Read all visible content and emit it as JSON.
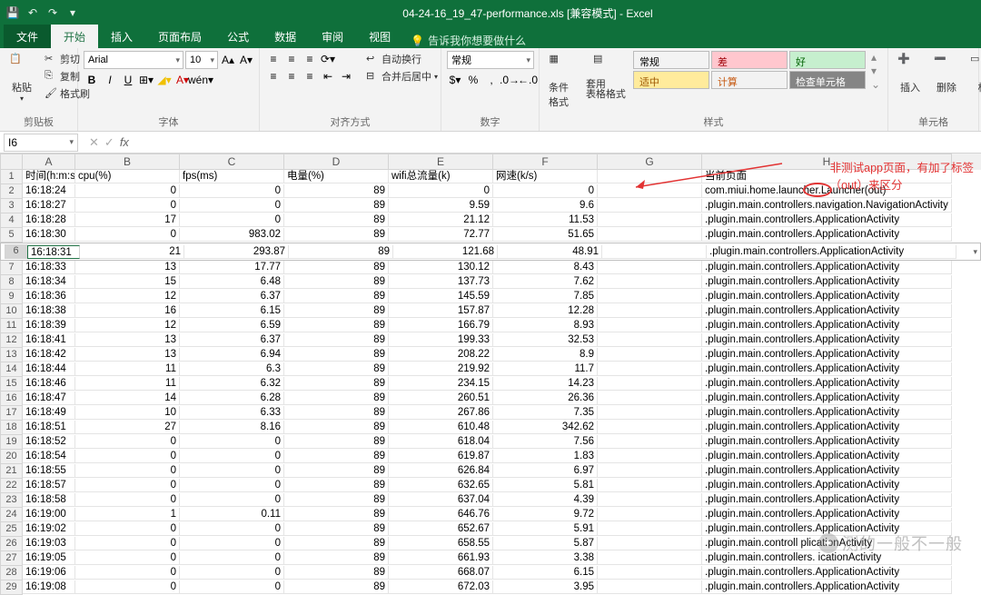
{
  "title": "04-24-16_19_47-performance.xls  [兼容模式]  -  Excel",
  "qat": {
    "save": "💾",
    "undo": "↶",
    "redo": "↷",
    "custom": "▾"
  },
  "tabs": {
    "file": "文件",
    "home": "开始",
    "insert": "插入",
    "layout": "页面布局",
    "formula": "公式",
    "data": "数据",
    "review": "审阅",
    "view": "视图",
    "tell_me": "告诉我你想要做什么"
  },
  "ribbon": {
    "clipboard": {
      "label": "剪贴板",
      "paste": "粘贴",
      "cut": "剪切",
      "copy": "复制",
      "painter": "格式刷"
    },
    "font": {
      "label": "字体",
      "name": "Arial",
      "size": "10",
      "bold": "B",
      "italic": "I",
      "underline": "U"
    },
    "align": {
      "label": "对齐方式",
      "wrap": "自动换行",
      "merge": "合并后居中"
    },
    "number": {
      "label": "数字",
      "format": "常规"
    },
    "styles": {
      "label": "样式",
      "cond": "条件格式",
      "table": "套用\n表格格式",
      "normal": "常规",
      "bad": "差",
      "good": "好",
      "neutral": "适中",
      "calc": "计算",
      "check": "检查单元格"
    },
    "cells": {
      "label": "单元格",
      "insert": "插入",
      "delete": "删除",
      "format": "格"
    }
  },
  "namebox": "I6",
  "columns": [
    "A",
    "B",
    "C",
    "D",
    "E",
    "F",
    "G",
    "H"
  ],
  "headers": [
    "时间(h:m:s)",
    "cpu(%)",
    "fps(ms)",
    "电量(%)",
    "wifi总流量(k)",
    "网速(k/s)",
    "",
    "当前页面"
  ],
  "data": [
    [
      "16:18:24",
      "0",
      "0",
      "89",
      "0",
      "0",
      "com.miui.home.launcher.Launcher(out)"
    ],
    [
      "16:18:27",
      "0",
      "0",
      "89",
      "9.59",
      "9.6",
      ".plugin.main.controllers.navigation.NavigationActivity"
    ],
    [
      "16:18:28",
      "17",
      "0",
      "89",
      "21.12",
      "11.53",
      ".plugin.main.controllers.ApplicationActivity"
    ],
    [
      "16:18:30",
      "0",
      "983.02",
      "89",
      "72.77",
      "51.65",
      ".plugin.main.controllers.ApplicationActivity"
    ],
    [
      "16:18:31",
      "21",
      "293.87",
      "89",
      "121.68",
      "48.91",
      ".plugin.main.controllers.ApplicationActivity"
    ],
    [
      "16:18:33",
      "13",
      "17.77",
      "89",
      "130.12",
      "8.43",
      ".plugin.main.controllers.ApplicationActivity"
    ],
    [
      "16:18:34",
      "15",
      "6.48",
      "89",
      "137.73",
      "7.62",
      ".plugin.main.controllers.ApplicationActivity"
    ],
    [
      "16:18:36",
      "12",
      "6.37",
      "89",
      "145.59",
      "7.85",
      ".plugin.main.controllers.ApplicationActivity"
    ],
    [
      "16:18:38",
      "16",
      "6.15",
      "89",
      "157.87",
      "12.28",
      ".plugin.main.controllers.ApplicationActivity"
    ],
    [
      "16:18:39",
      "12",
      "6.59",
      "89",
      "166.79",
      "8.93",
      ".plugin.main.controllers.ApplicationActivity"
    ],
    [
      "16:18:41",
      "13",
      "6.37",
      "89",
      "199.33",
      "32.53",
      ".plugin.main.controllers.ApplicationActivity"
    ],
    [
      "16:18:42",
      "13",
      "6.94",
      "89",
      "208.22",
      "8.9",
      ".plugin.main.controllers.ApplicationActivity"
    ],
    [
      "16:18:44",
      "11",
      "6.3",
      "89",
      "219.92",
      "11.7",
      ".plugin.main.controllers.ApplicationActivity"
    ],
    [
      "16:18:46",
      "11",
      "6.32",
      "89",
      "234.15",
      "14.23",
      ".plugin.main.controllers.ApplicationActivity"
    ],
    [
      "16:18:47",
      "14",
      "6.28",
      "89",
      "260.51",
      "26.36",
      ".plugin.main.controllers.ApplicationActivity"
    ],
    [
      "16:18:49",
      "10",
      "6.33",
      "89",
      "267.86",
      "7.35",
      ".plugin.main.controllers.ApplicationActivity"
    ],
    [
      "16:18:51",
      "27",
      "8.16",
      "89",
      "610.48",
      "342.62",
      ".plugin.main.controllers.ApplicationActivity"
    ],
    [
      "16:18:52",
      "0",
      "0",
      "89",
      "618.04",
      "7.56",
      ".plugin.main.controllers.ApplicationActivity"
    ],
    [
      "16:18:54",
      "0",
      "0",
      "89",
      "619.87",
      "1.83",
      ".plugin.main.controllers.ApplicationActivity"
    ],
    [
      "16:18:55",
      "0",
      "0",
      "89",
      "626.84",
      "6.97",
      ".plugin.main.controllers.ApplicationActivity"
    ],
    [
      "16:18:57",
      "0",
      "0",
      "89",
      "632.65",
      "5.81",
      ".plugin.main.controllers.ApplicationActivity"
    ],
    [
      "16:18:58",
      "0",
      "0",
      "89",
      "637.04",
      "4.39",
      ".plugin.main.controllers.ApplicationActivity"
    ],
    [
      "16:19:00",
      "1",
      "0.11",
      "89",
      "646.76",
      "9.72",
      ".plugin.main.controllers.ApplicationActivity"
    ],
    [
      "16:19:02",
      "0",
      "0",
      "89",
      "652.67",
      "5.91",
      ".plugin.main.controllers.ApplicationActivity"
    ],
    [
      "16:19:03",
      "0",
      "0",
      "89",
      "658.55",
      "5.87",
      ".plugin.main.controll            plicationActivity"
    ],
    [
      "16:19:05",
      "0",
      "0",
      "89",
      "661.93",
      "3.38",
      ".plugin.main.controllers.      icationActivity"
    ],
    [
      "16:19:06",
      "0",
      "0",
      "89",
      "668.07",
      "6.15",
      ".plugin.main.controllers.ApplicationActivity"
    ],
    [
      "16:19:08",
      "0",
      "0",
      "89",
      "672.03",
      "3.95",
      ".plugin.main.controllers.ApplicationActivity"
    ]
  ],
  "annotation": {
    "l1": "非测试app页面，有加了标签",
    "l2": "（out）来区分"
  },
  "watermark": "测的一般不一般"
}
